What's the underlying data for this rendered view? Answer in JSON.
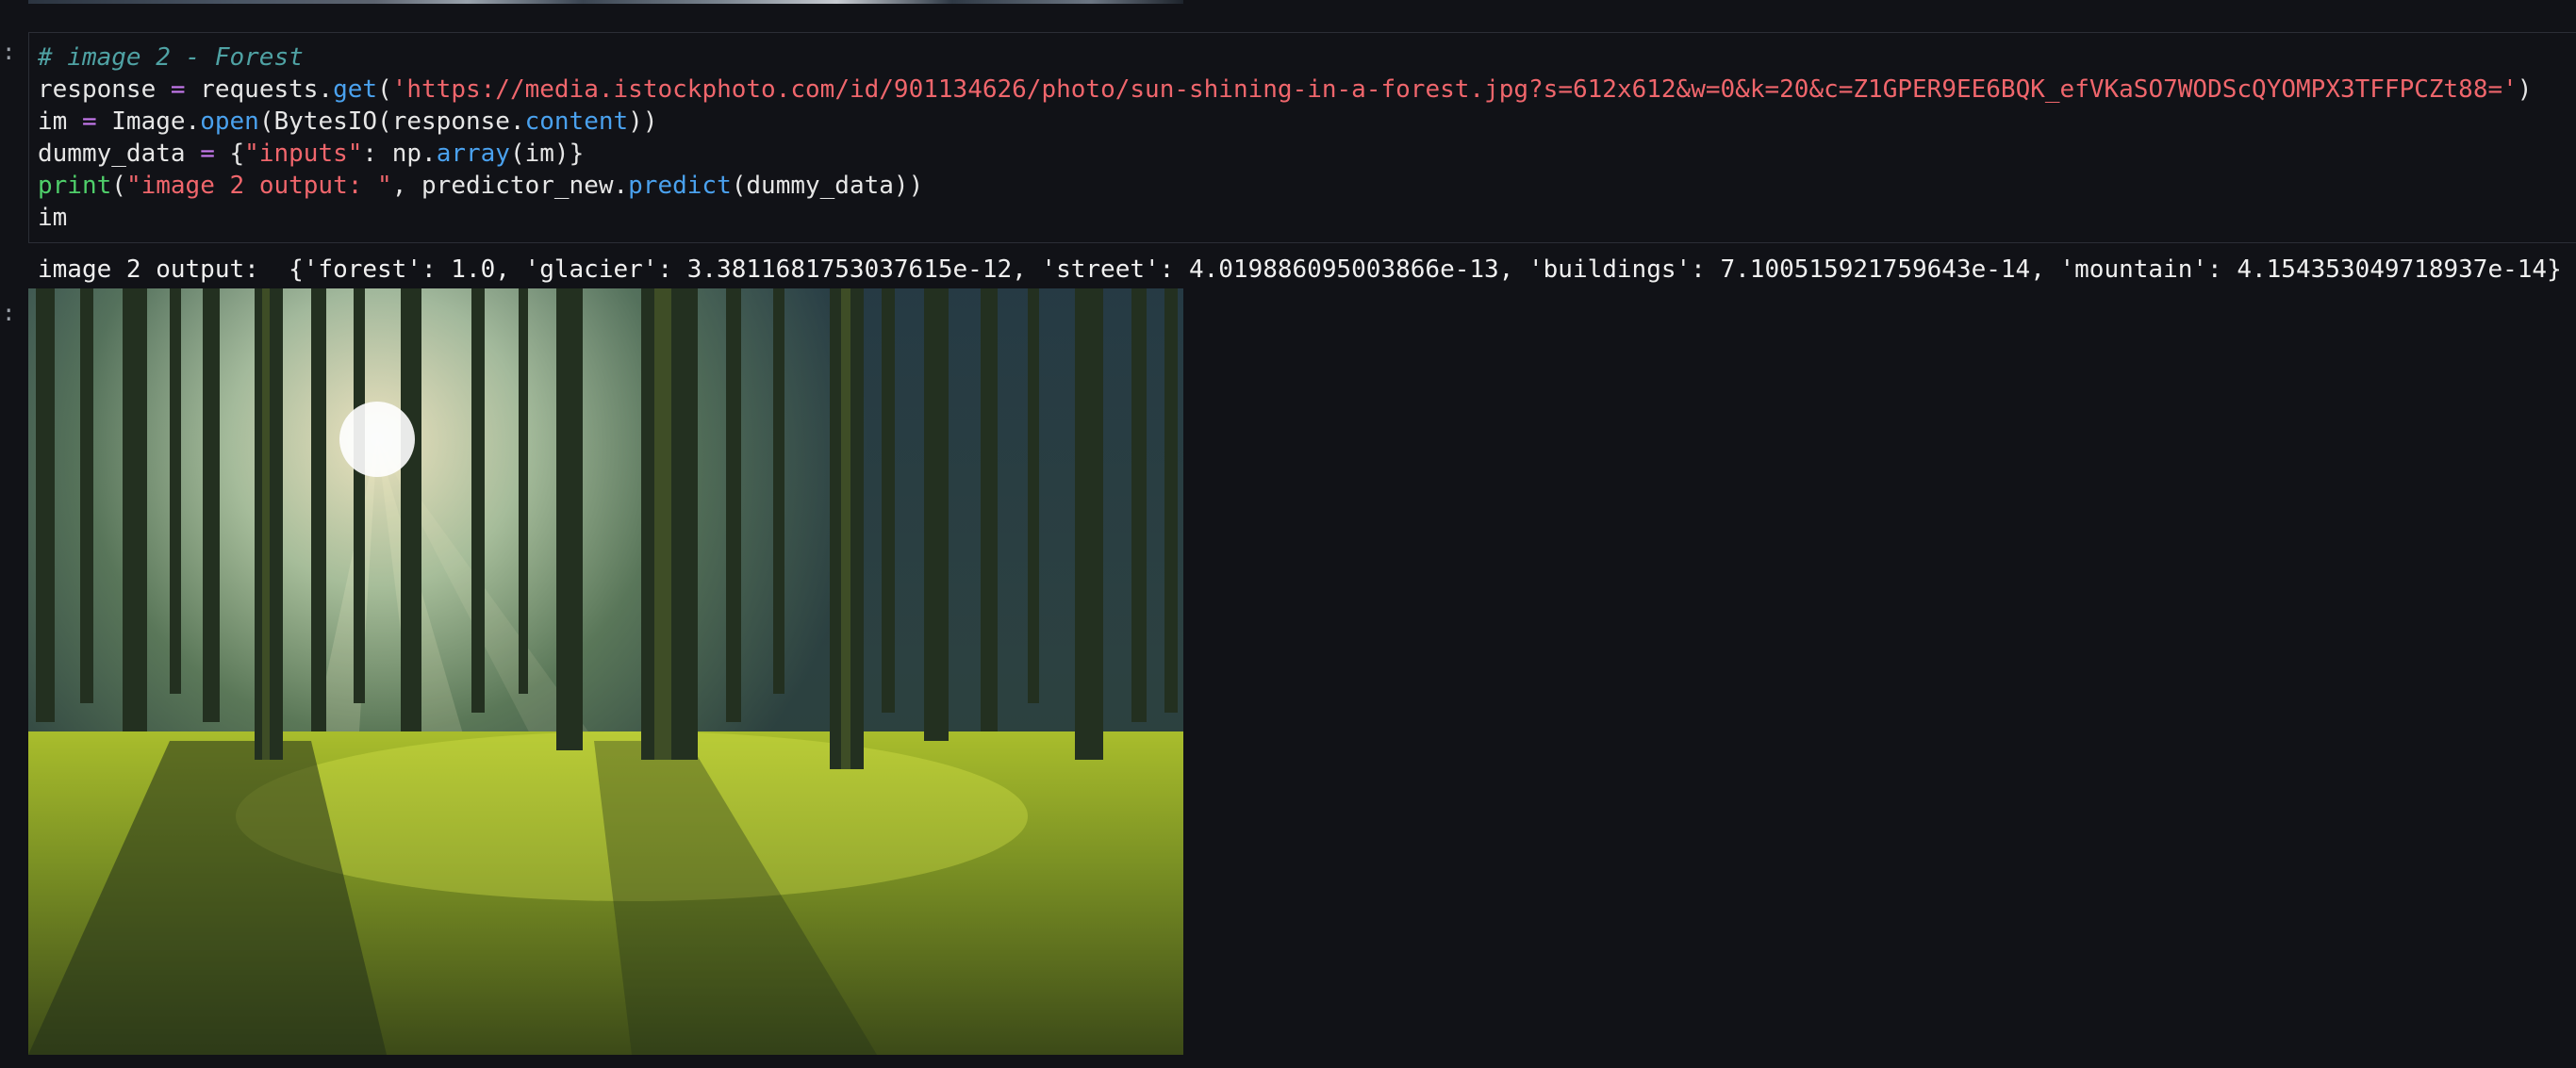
{
  "cell": {
    "prompt_input": ":",
    "prompt_output": ":",
    "code": {
      "line1": "# image 2 - Forest",
      "line2_a": "response",
      "line2_b": " = ",
      "line2_c": "requests.",
      "line2_d": "get",
      "line2_e": "(",
      "line2_url": "'https://media.istockphoto.com/id/901134626/photo/sun-shining-in-a-forest.jpg?s=612x612&w=0&k=20&c=Z1GPER9EE6BQK_efVKaSO7WODScQYOMPX3TFFPCZt88='",
      "line2_f": ")",
      "line3_a": "im",
      "line3_b": " = ",
      "line3_c": "Image.",
      "line3_d": "open",
      "line3_e": "(BytesIO(response.",
      "line3_f": "content",
      "line3_g": "))",
      "line4_a": "dummy_data",
      "line4_b": " = ",
      "line4_c": "{",
      "line4_d": "\"inputs\"",
      "line4_e": ": np.",
      "line4_f": "array",
      "line4_g": "(im)}",
      "line5_a": "print",
      "line5_b": "(",
      "line5_c": "\"image 2 output: \"",
      "line5_d": ", predictor_new.",
      "line5_e": "predict",
      "line5_f": "(dummy_data))",
      "line6": "im"
    },
    "stdout": "image 2 output:  {'forest': 1.0, 'glacier': 3.3811681753037615e-12, 'street': 4.019886095003866e-13, 'buildings': 7.100515921759643e-14, 'mountain': 4.154353049718937e-14}"
  },
  "colors": {
    "background": "#111217",
    "comment": "#4fa2a4",
    "string": "#f0666c",
    "operator": "#c879f0",
    "function": "#4aa1ee",
    "builtin": "#4fcf6a"
  },
  "image_output": {
    "subject": "sunlit forest photo"
  }
}
